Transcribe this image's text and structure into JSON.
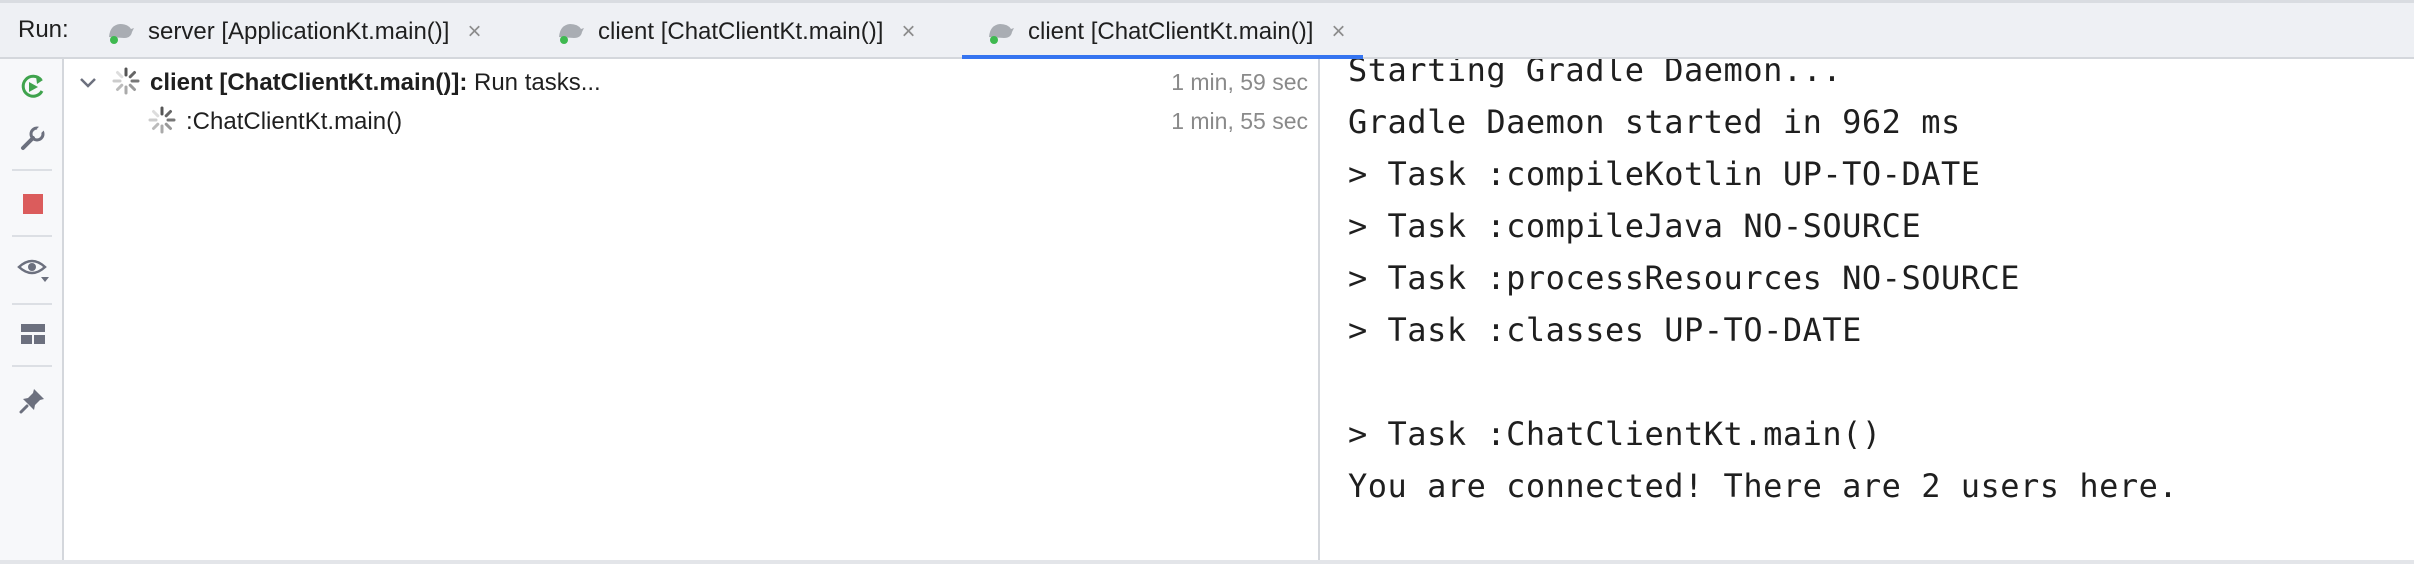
{
  "run_bar": {
    "label": "Run:",
    "tabs": [
      {
        "label": "server [ApplicationKt.main()]",
        "active": false
      },
      {
        "label": "client [ChatClientKt.main()]",
        "active": false
      },
      {
        "label": "client [ChatClientKt.main()]",
        "active": true
      }
    ],
    "close_glyph": "×",
    "accent_color": "#3574f0"
  },
  "tool_strip": {
    "buttons": [
      "rerun-icon",
      "wrench-icon",
      "stop-icon",
      "eye-icon",
      "layout-icon",
      "pin-icon"
    ]
  },
  "tree": {
    "rows": [
      {
        "bold_label": "client [ChatClientKt.main()]:",
        "label": " Run tasks...",
        "time": "1 min, 59 sec"
      },
      {
        "label": ":ChatClientKt.main()",
        "time": "1 min, 55 sec"
      }
    ]
  },
  "console": {
    "lines": [
      "Starting Gradle Daemon...",
      "Gradle Daemon started in 962 ms",
      "> Task :compileKotlin UP-TO-DATE",
      "> Task :compileJava NO-SOURCE",
      "> Task :processResources NO-SOURCE",
      "> Task :classes UP-TO-DATE",
      "",
      "> Task :ChatClientKt.main()",
      "You are connected! There are 2 users here."
    ]
  }
}
